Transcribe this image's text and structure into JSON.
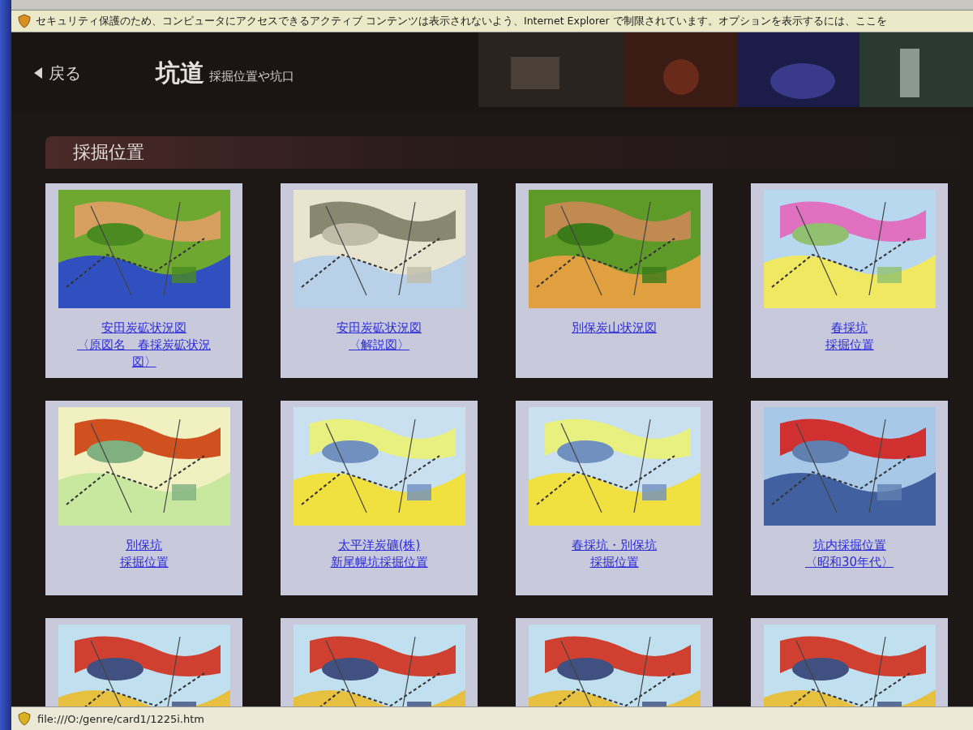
{
  "info_bar": {
    "text": "セキュリティ保護のため、コンピュータにアクセスできるアクティブ コンテンツは表示されないよう、Internet Explorer で制限されています。オプションを表示するには、ここを"
  },
  "header": {
    "back": "戻る",
    "title": "坑道",
    "subtitle": "採掘位置や坑口"
  },
  "section": {
    "heading": "採掘位置"
  },
  "cards": [
    {
      "kind": "picture",
      "lines": [
        "安田炭砿状況図",
        "〈原図名　春採炭砿状況",
        "図〉"
      ]
    },
    {
      "kind": "picture",
      "lines": [
        "安田炭砿状況図",
        "〈解説図〉"
      ]
    },
    {
      "kind": "picture",
      "lines": [
        "別保炭山状況図"
      ]
    },
    {
      "kind": "picture",
      "lines": [
        "春採坑",
        "採掘位置"
      ]
    },
    {
      "kind": "picture",
      "lines": [
        "別保坑",
        "採掘位置"
      ]
    },
    {
      "kind": "picture",
      "lines": [
        "太平洋炭礦(株)",
        "新尾幌坑採掘位置"
      ]
    },
    {
      "kind": "picture",
      "lines": [
        "春採坑・別保坑",
        "採掘位置"
      ]
    },
    {
      "kind": "picture",
      "lines": [
        "坑内採掘位置",
        "〈昭和30年代〉"
      ]
    },
    {
      "kind": "picture"
    },
    {
      "kind": "picture"
    },
    {
      "kind": "picture"
    },
    {
      "kind": "picture"
    }
  ],
  "status_bar": {
    "url": "file:///O:/genre/card1/1225i.htm"
  }
}
